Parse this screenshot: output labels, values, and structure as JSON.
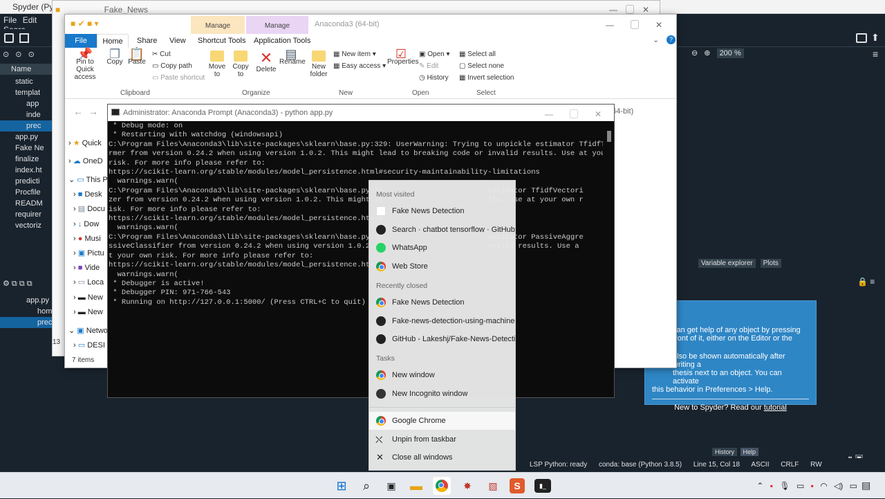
{
  "spyder": {
    "title": "Spyder (Pyth",
    "menu": [
      "File",
      "Edit",
      "Searc"
    ],
    "files_header": "Name",
    "files": [
      "static",
      "templat",
      "app",
      "inde",
      "prec",
      "app.py",
      "Fake Ne",
      "finalize",
      "index.ht",
      "predicti",
      "Procfile",
      "READM",
      "requirer",
      "vectoriz"
    ],
    "outline": [
      "app.py",
      "hom",
      "prec"
    ],
    "zoom": "200 %",
    "right_tabs": [
      "Variable explorer",
      "Plots"
    ],
    "help_text_1": "can get help of any object by pressing",
    "help_text_2": "front of it, either on the Editor or the",
    "help_text_3": "also be shown automatically after writing a",
    "help_text_4": "thesis next to an object. You can activate",
    "help_text_5": "this behavior in Preferences > Help.",
    "help_footer": "New to Spyder? Read our",
    "help_link": "tutorial",
    "bottom_tabs": [
      "History",
      "Help"
    ],
    "status": [
      "LSP Python: ready",
      "conda: base (Python 3.8.5)",
      "Line 15, Col 18",
      "ASCII",
      "CRLF",
      "RW"
    ],
    "line_num": "13"
  },
  "explorer": {
    "back_title": "Fake_News",
    "manage1": "Manage",
    "manage2": "Manage",
    "title": "Anaconda3 (64-bit)",
    "tabs": [
      "File",
      "Home",
      "Share",
      "View",
      "Shortcut Tools",
      "Application Tools"
    ],
    "clipboard": {
      "pin": "Pin to Quick access",
      "copy": "Copy",
      "paste": "Paste",
      "cut": "Cut",
      "copy_path": "Copy path",
      "paste_shortcut": "Paste shortcut",
      "group": "Clipboard"
    },
    "organize": {
      "move": "Move to",
      "copy": "Copy to",
      "delete": "Delete",
      "rename": "Rename",
      "group": "Organize"
    },
    "new": {
      "folder": "New folder",
      "item": "New item",
      "easy": "Easy access",
      "group": "New"
    },
    "open": {
      "props": "Properties",
      "open": "Open",
      "edit": "Edit",
      "history": "History",
      "group": "Open"
    },
    "select": {
      "all": "Select all",
      "none": "Select none",
      "invert": "Invert selection",
      "group": "Select"
    },
    "nav": [
      "Quick",
      "OneD",
      "This P",
      "Desk",
      "Docu",
      "Dow",
      "Musi",
      "Pictu",
      "Vide",
      "Loca",
      "New",
      "New",
      "Netwo",
      "DESI"
    ],
    "items": "7 items",
    "addr_right": "da3 (64-bit)"
  },
  "terminal": {
    "title": "Administrator: Anaconda Prompt (Anaconda3) - python  app.py",
    "lines": [
      " * Debug mode: on",
      " * Restarting with watchdog (windowsapi)",
      "C:\\Program Files\\Anaconda3\\lib\\site-packages\\sklearn\\base.py:329: UserWarning: Trying to unpickle estimator TfidfTransfo",
      "rmer from version 0.24.2 when using version 1.0.2. This might lead to breaking code or invalid results. Use at your own",
      "risk. For more info please refer to:",
      "https://scikit-learn.org/stable/modules/model_persistence.html#security-maintainability-limitations",
      "  warnings.warn(",
      "C:\\Program Files\\Anaconda3\\lib\\site-packages\\sklearn\\base.py:32                        estimator TfidfVectori",
      "zer from version 0.24.2 when using version 1.0.2. This might le                        lts. Use at your own r",
      "isk. For more info please refer to:",
      "https://scikit-learn.org/stable/modules/model_persistence.html#",
      "  warnings.warn(",
      "C:\\Program Files\\Anaconda3\\lib\\site-packages\\sklearn\\base.py:32                        estimator PassiveAggre",
      "ssiveClassifier from version 0.24.2 when using version 1.0.2. T                        nvalid results. Use a",
      "t your own risk. For more info please refer to:",
      "https://scikit-learn.org/stable/modules/model_persistence.html#",
      "  warnings.warn(",
      " * Debugger is active!",
      " * Debugger PIN: 971-766-543",
      " * Running on http://127.0.0.1:5000/ (Press CTRL+C to quit)"
    ]
  },
  "jumplist": {
    "most_visited": "Most visited",
    "mv": [
      "Fake News Detection",
      "Search · chatbot tensorflow · GitHub",
      "WhatsApp",
      "Web Store"
    ],
    "recently_closed": "Recently closed",
    "rc": [
      "Fake News Detection",
      "Fake-news-detection-using-machine-l...",
      "GitHub - Lakeshj/Fake-News-Detectio..."
    ],
    "tasks": "Tasks",
    "tk": [
      "New window",
      "New Incognito window"
    ],
    "app": "Google Chrome",
    "unpin": "Unpin from taskbar",
    "close_all": "Close all windows"
  },
  "taskbar": {
    "icons": [
      "start-icon",
      "search-icon",
      "task-view-icon",
      "file-explorer-icon",
      "chrome-icon",
      "spyder-icon",
      "anaconda-icon",
      "sublime-icon",
      "terminal-icon"
    ]
  }
}
